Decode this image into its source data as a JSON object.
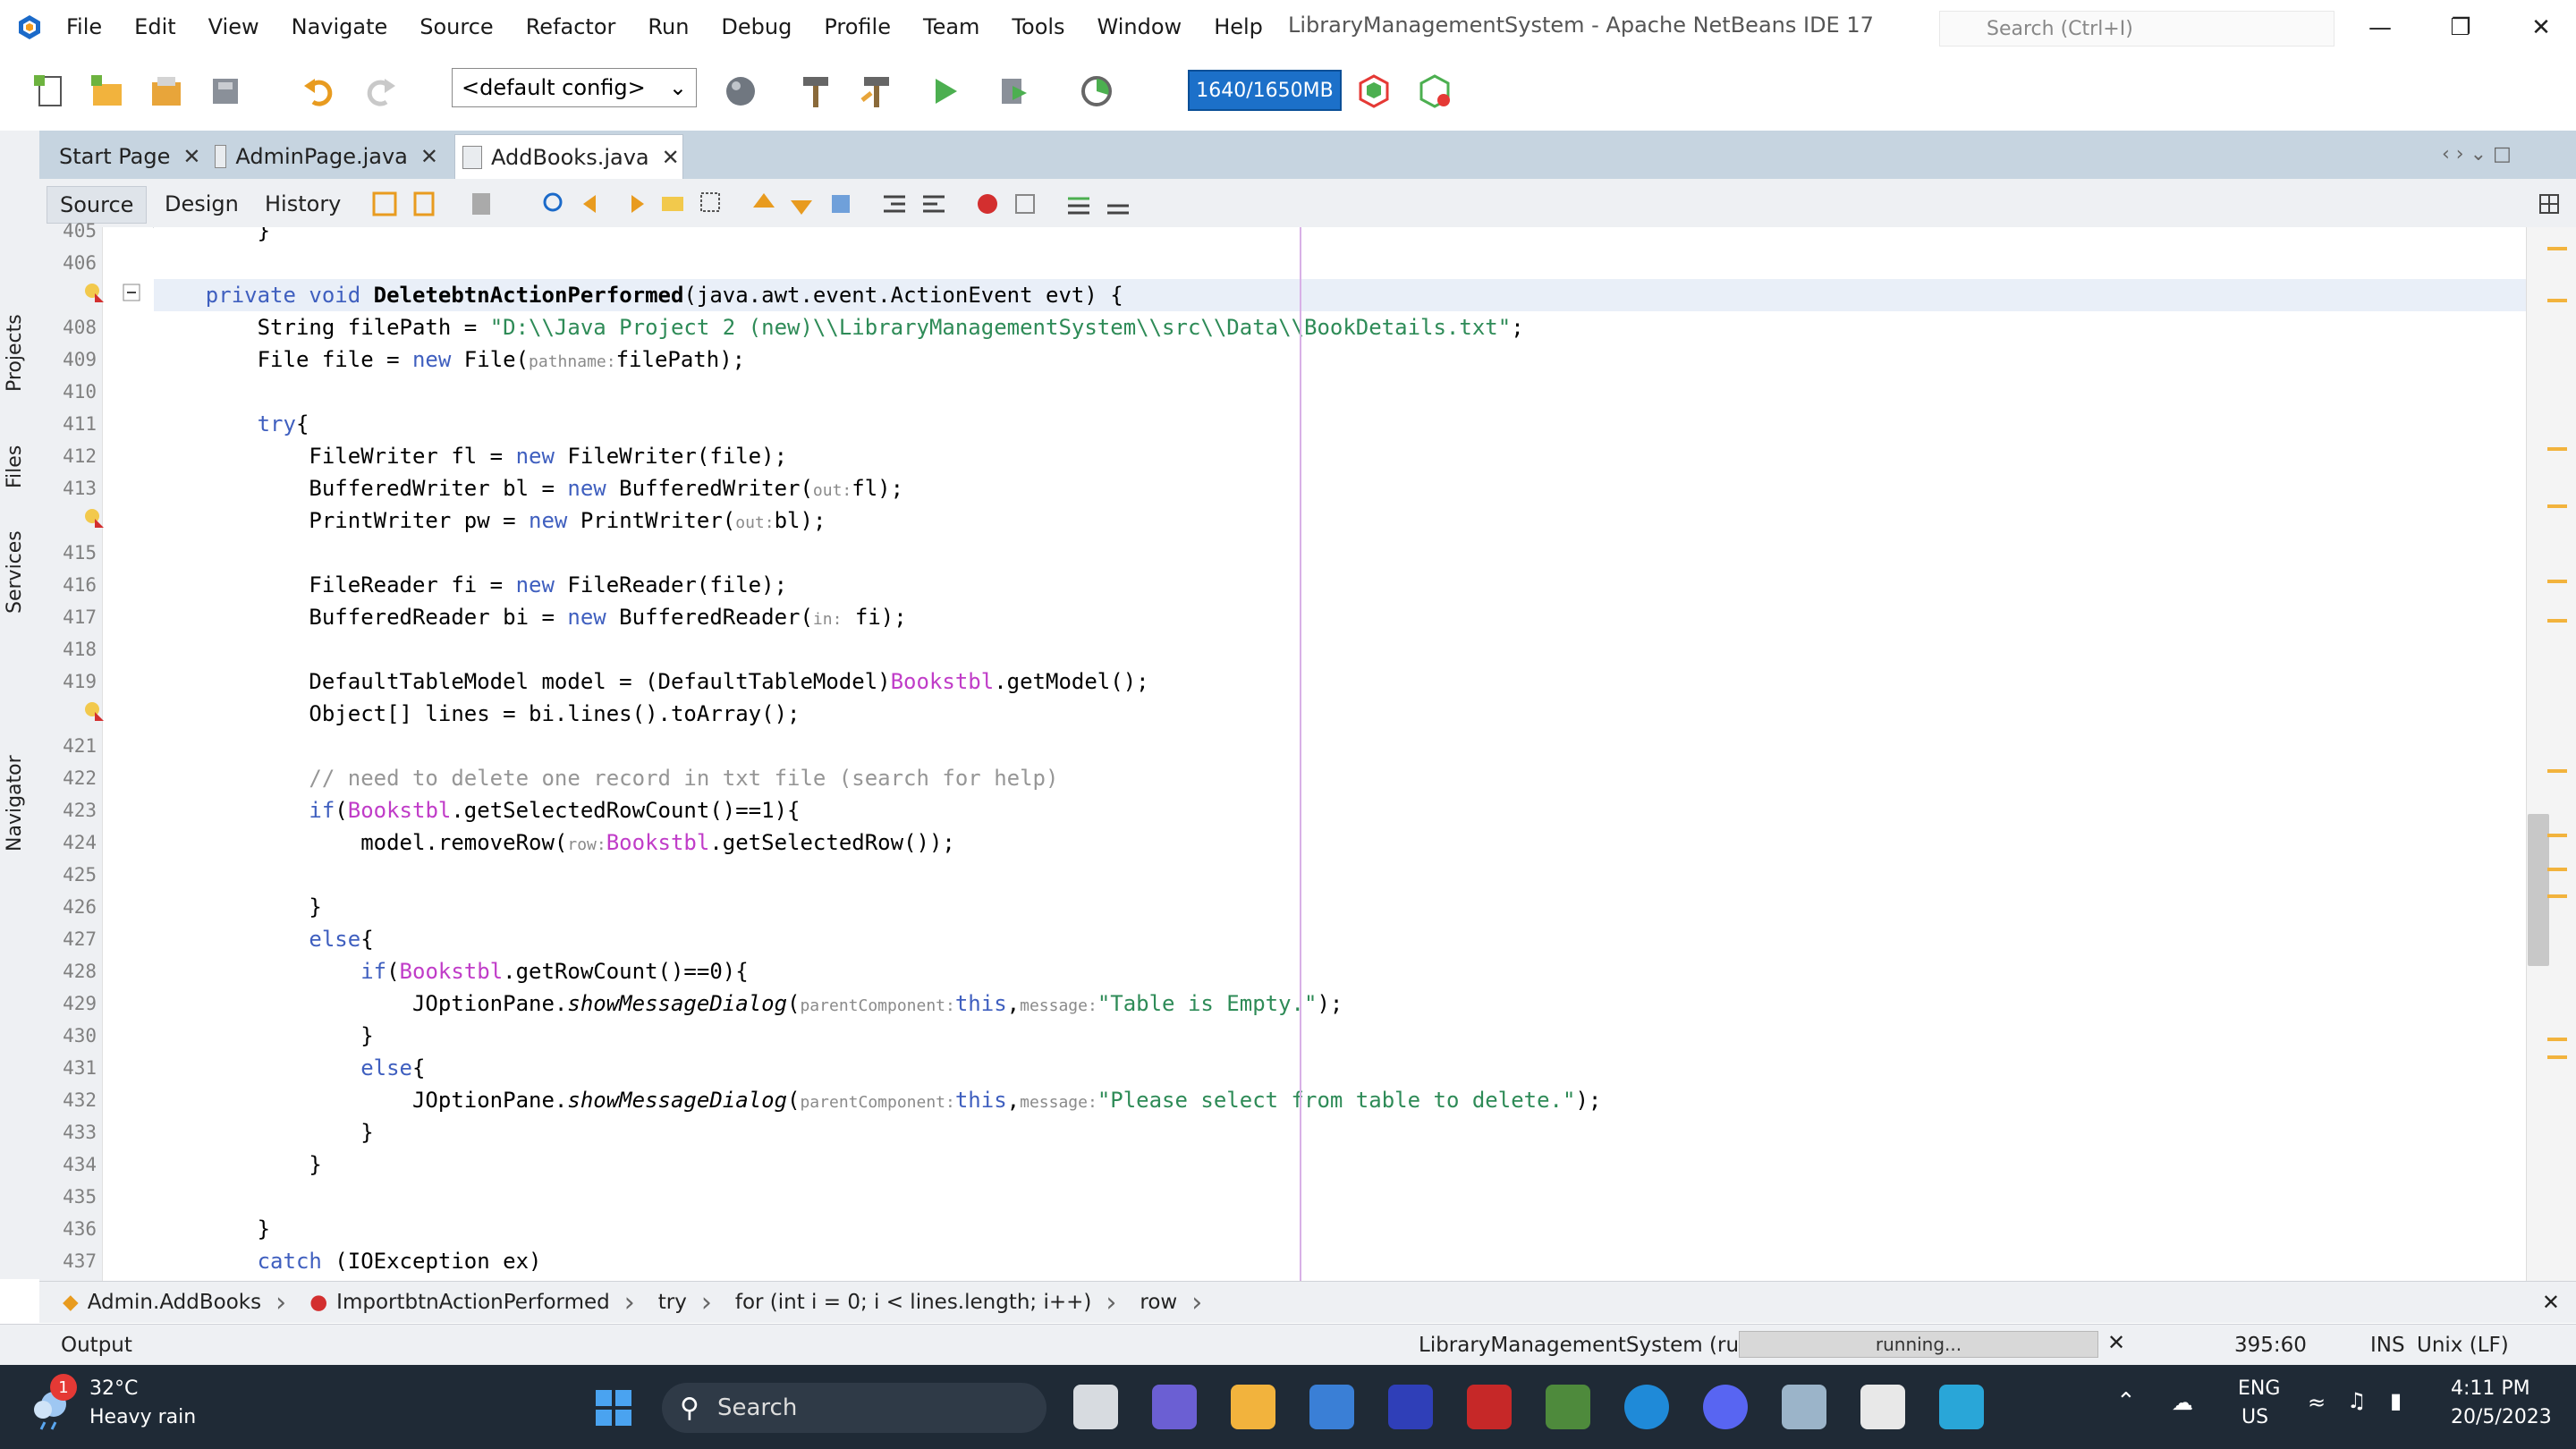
{
  "menu": {
    "items": [
      "File",
      "Edit",
      "View",
      "Navigate",
      "Source",
      "Refactor",
      "Run",
      "Debug",
      "Profile",
      "Team",
      "Tools",
      "Window",
      "Help"
    ],
    "title": "LibraryManagementSystem - Apache NetBeans IDE 17",
    "search_placeholder": "Search (Ctrl+I)"
  },
  "toolbar": {
    "config": "<default config>",
    "memory": "1640/1650MB"
  },
  "side_tabs": [
    "Projects",
    "Files",
    "Services",
    "Navigator"
  ],
  "editor_tabs": [
    {
      "label": "Start Page"
    },
    {
      "label": "AdminPage.java"
    },
    {
      "label": "AddBooks.java"
    }
  ],
  "views": [
    "Source",
    "Design",
    "History"
  ],
  "code": [
    {
      "n": "405",
      "t": "        }"
    },
    {
      "n": "406",
      "t": ""
    },
    {
      "n": "407",
      "t": "    private void DeletebtnActionPerformed(java.awt.event.ActionEvent evt) {"
    },
    {
      "n": "408",
      "t": "        String filePath = \"D:\\\\Java Project 2 (new)\\\\LibraryManagementSystem\\\\src\\\\Data\\\\BookDetails.txt\";"
    },
    {
      "n": "409",
      "t": "        File file = new File(pathname:filePath);"
    },
    {
      "n": "410",
      "t": ""
    },
    {
      "n": "411",
      "t": "        try{"
    },
    {
      "n": "412",
      "t": "            FileWriter fl = new FileWriter(file);"
    },
    {
      "n": "413",
      "t": "            BufferedWriter bl = new BufferedWriter(out:fl);"
    },
    {
      "n": "414",
      "t": "            PrintWriter pw = new PrintWriter(out:bl);"
    },
    {
      "n": "415",
      "t": ""
    },
    {
      "n": "416",
      "t": "            FileReader fi = new FileReader(file);"
    },
    {
      "n": "417",
      "t": "            BufferedReader bi = new BufferedReader(in: fi);"
    },
    {
      "n": "418",
      "t": ""
    },
    {
      "n": "419",
      "t": "            DefaultTableModel model = (DefaultTableModel)Bookstbl.getModel();"
    },
    {
      "n": "420",
      "t": "            Object[] lines = bi.lines().toArray();"
    },
    {
      "n": "421",
      "t": ""
    },
    {
      "n": "422",
      "t": "            // need to delete one record in txt file (search for help)"
    },
    {
      "n": "423",
      "t": "            if(Bookstbl.getSelectedRowCount()==1){"
    },
    {
      "n": "424",
      "t": "                model.removeRow(row:Bookstbl.getSelectedRow());"
    },
    {
      "n": "425",
      "t": ""
    },
    {
      "n": "426",
      "t": "            }"
    },
    {
      "n": "427",
      "t": "            else{"
    },
    {
      "n": "428",
      "t": "                if(Bookstbl.getRowCount()==0){"
    },
    {
      "n": "429",
      "t": "                    JOptionPane.showMessageDialog(parentComponent:this,message:\"Table is Empty.\");"
    },
    {
      "n": "430",
      "t": "                }"
    },
    {
      "n": "431",
      "t": "                else{"
    },
    {
      "n": "432",
      "t": "                    JOptionPane.showMessageDialog(parentComponent:this,message:\"Please select from table to delete.\");"
    },
    {
      "n": "433",
      "t": "                }"
    },
    {
      "n": "434",
      "t": "            }"
    },
    {
      "n": "435",
      "t": ""
    },
    {
      "n": "436",
      "t": "        }"
    },
    {
      "n": "437",
      "t": "        catch (IOException ex)"
    }
  ],
  "breadcrumb": [
    "Admin.AddBooks",
    "ImportbtnActionPerformed",
    "try",
    "for (int i = 0; i < lines.length; i++)",
    "row"
  ],
  "status": {
    "output_label": "Output",
    "run_label": "LibraryManagementSystem (run)",
    "progress_text": "running...",
    "position": "395:60",
    "mode": "INS",
    "line_ending": "Unix (LF)"
  },
  "taskbar": {
    "weather_temp": "32°C",
    "weather_desc": "Heavy rain",
    "weather_badge": "1",
    "search_label": "Search",
    "lang": "ENG",
    "region": "US",
    "time": "4:11 PM",
    "date": "20/5/2023"
  },
  "colors": {
    "keyword": "#3f5fbf",
    "string": "#2e8b57",
    "field": "#c03cc8",
    "memory_bar": "#1c70c9",
    "taskbar_bg": "#1f2a36"
  }
}
